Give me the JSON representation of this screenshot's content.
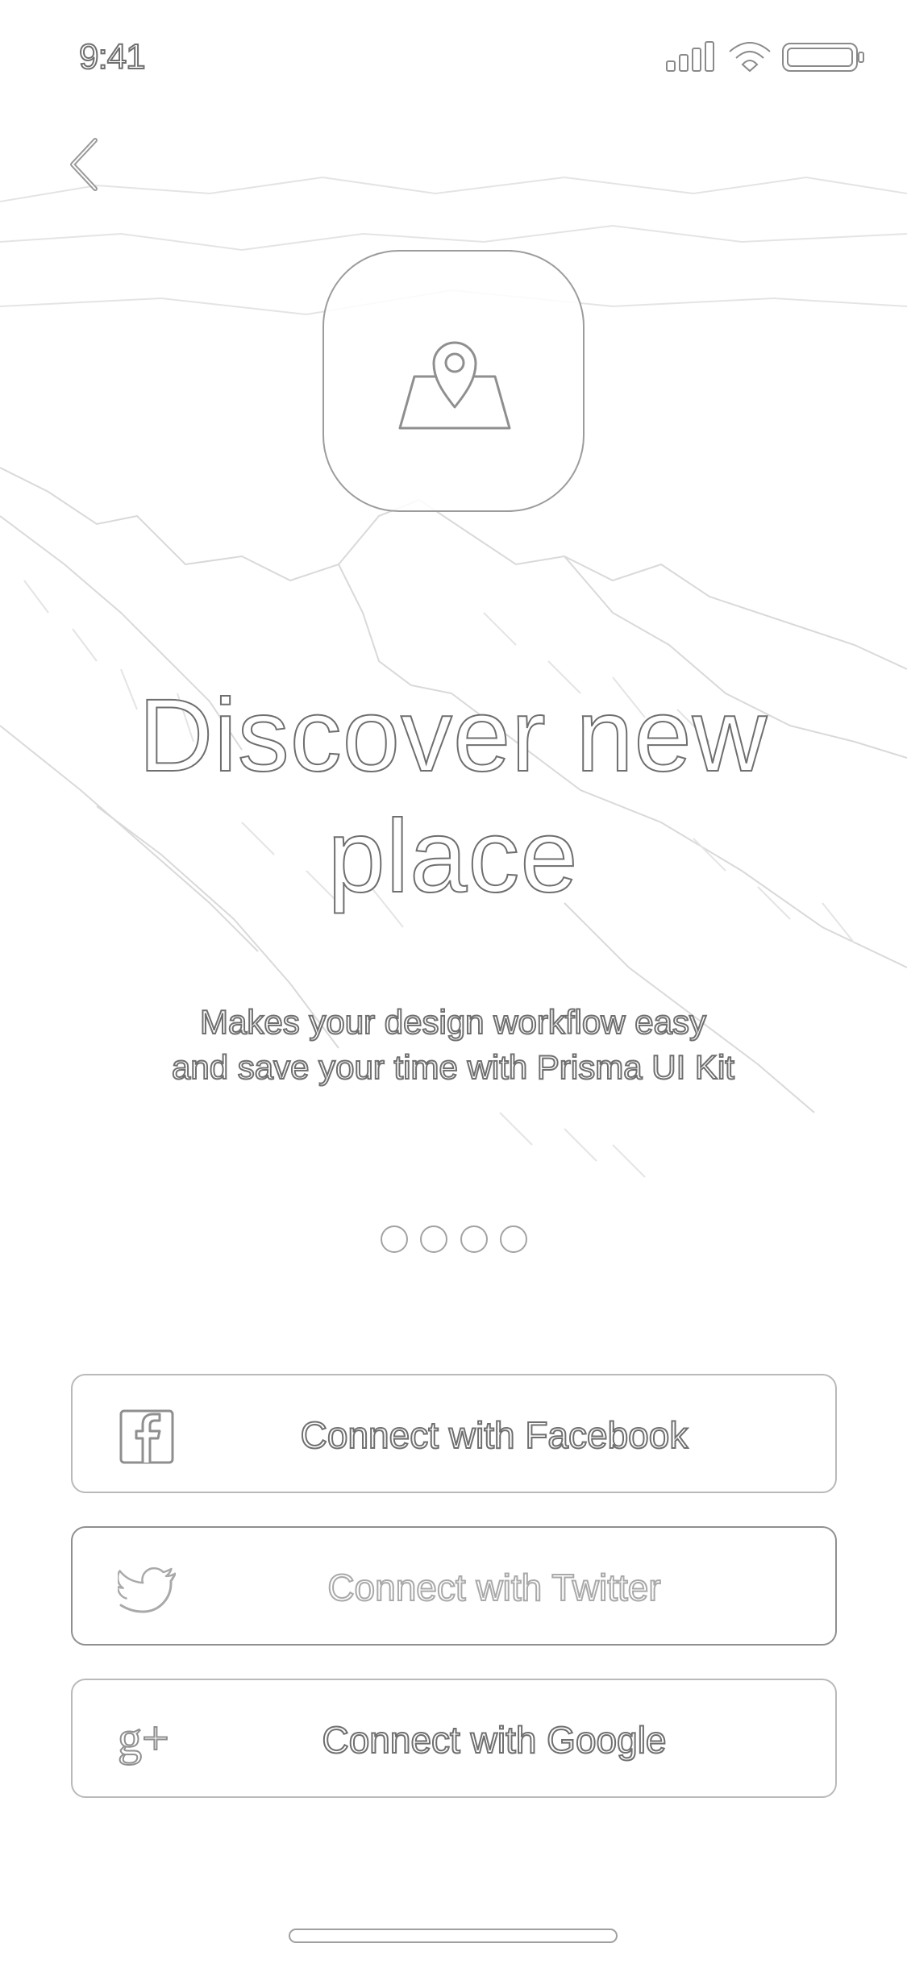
{
  "status_bar": {
    "time": "9:41",
    "signal_icon": "cellular-signal-icon",
    "wifi_icon": "wifi-icon",
    "battery_icon": "battery-icon"
  },
  "nav": {
    "back_icon": "chevron-left-icon"
  },
  "hero": {
    "tile_icon": "map-location-pin-icon",
    "title": "Discover new place",
    "subtitle_line1": "Makes your design workflow easy",
    "subtitle_line2": "and save your time with Prisma UI Kit"
  },
  "pager": {
    "page_count": 4,
    "current_page": 1
  },
  "social": {
    "facebook": {
      "label": "Connect with Facebook",
      "icon": "facebook-icon"
    },
    "twitter": {
      "label": "Connect with Twitter",
      "icon": "twitter-bird-icon"
    },
    "google": {
      "label": "Connect with Google",
      "icon": "google-plus-icon"
    }
  },
  "colors": {
    "background": "#ffffff",
    "outline": "#6f6f6f",
    "border": "#b9b9b9"
  }
}
